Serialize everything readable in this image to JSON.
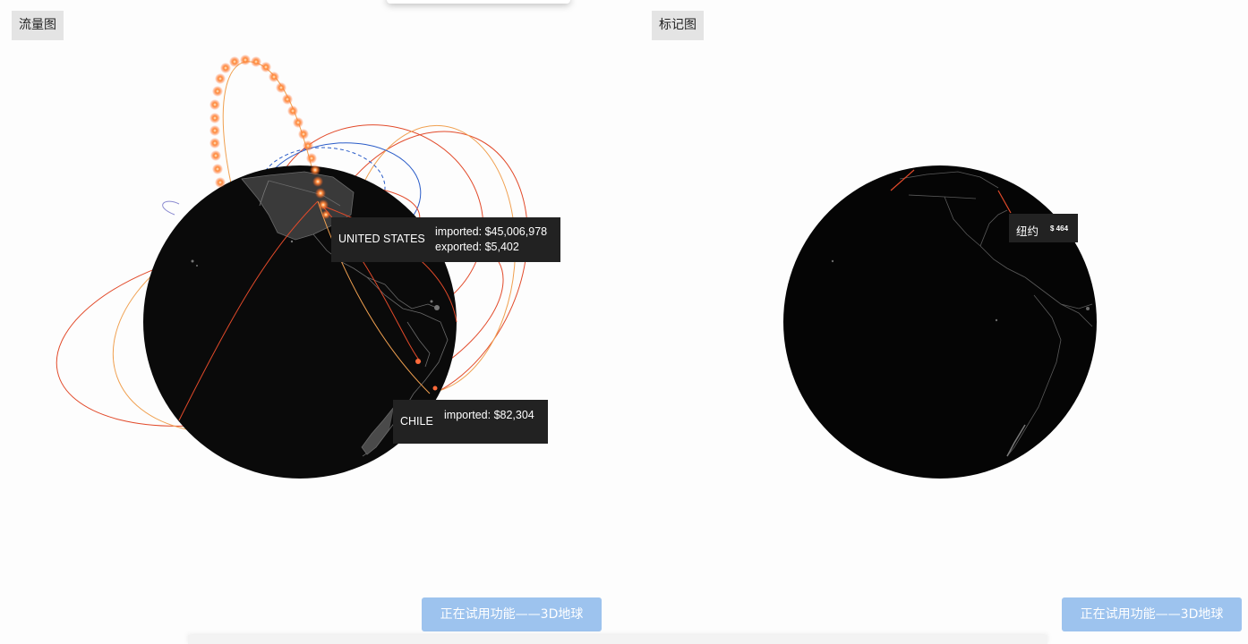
{
  "left_panel": {
    "tab_label": "流量图",
    "tooltips": {
      "us": {
        "name": "UNITED STATES",
        "line1": "imported: $45,006,978",
        "line2": "exported: $5,402"
      },
      "chile": {
        "name": "CHILE",
        "line1": "imported: $82,304"
      }
    },
    "trial_button": "正在试用功能——3D地球"
  },
  "right_panel": {
    "tab_label": "标记图",
    "tooltip": {
      "name": "纽约",
      "value": "$ 464"
    },
    "trial_button": "正在试用功能——3D地球"
  },
  "colors": {
    "globe": "#0a0a0a",
    "land_line": "#6a6a6a",
    "arc_red": "#e24a2a",
    "arc_orange": "#f0a050",
    "arc_blue": "#2a5cc8",
    "tooltip_bg": "#222222",
    "tab_bg": "#e4e4e4",
    "button_bg": "#9dc3ee"
  }
}
